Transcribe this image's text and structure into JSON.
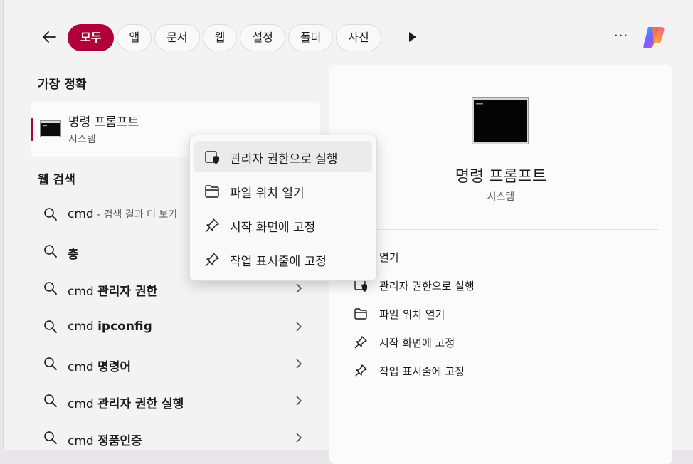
{
  "filters": {
    "back_icon": "back-arrow-icon",
    "chips": [
      "모두",
      "앱",
      "문서",
      "웹",
      "설정",
      "폴더",
      "사진"
    ],
    "active_index": 0,
    "more_label": "···",
    "accent": "#b0003a"
  },
  "best_match": {
    "section": "가장 정확",
    "title": "명령 프롬프트",
    "subtitle": "시스템"
  },
  "web": {
    "section": "웹 검색",
    "suggestions": [
      {
        "query": "cmd",
        "rest": "",
        "hint": " - 검색 결과 더 보기"
      },
      {
        "query": "",
        "rest": "층",
        "hint": ""
      },
      {
        "query": "cmd ",
        "rest": "관리자 권한",
        "hint": ""
      },
      {
        "query": "cmd ",
        "rest": "ipconfig",
        "hint": ""
      },
      {
        "query": "cmd ",
        "rest": "명령어",
        "hint": ""
      },
      {
        "query": "cmd ",
        "rest": "관리자 권한 실행",
        "hint": ""
      },
      {
        "query": "cmd ",
        "rest": "정품인증",
        "hint": ""
      }
    ]
  },
  "preview": {
    "title": "명령 프롬프트",
    "subtitle": "시스템",
    "actions": [
      "열기",
      "관리자 권한으로 실행",
      "파일 위치 열기",
      "시작 화면에 고정",
      "작업 표시줄에 고정"
    ]
  },
  "context_menu": {
    "items": [
      "관리자 권한으로 실행",
      "파일 위치 열기",
      "시작 화면에 고정",
      "작업 표시줄에 고정"
    ]
  }
}
